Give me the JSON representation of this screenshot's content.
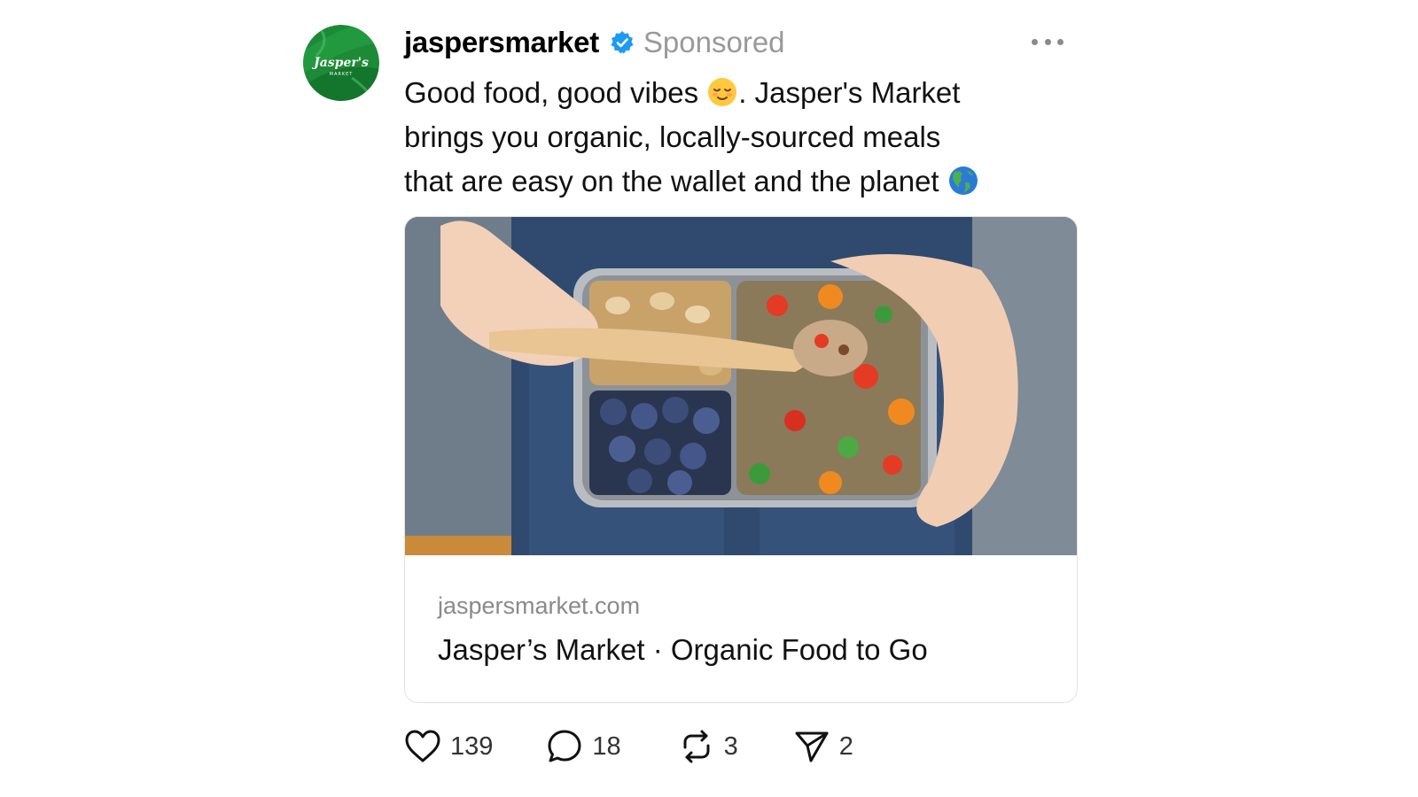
{
  "post": {
    "username": "jaspersmarket",
    "sponsored_label": "Sponsored",
    "avatar_logo_text": "Jasper's",
    "avatar_logo_subtext": "MARKET",
    "caption": {
      "line1_before_emoji": "Good food, good vibes ",
      "emoji1": "relieved-face",
      "line1_after_emoji": ". Jasper's Market",
      "line2": "brings you organic, locally-sourced meals",
      "line3_before_emoji": "that are easy on the wallet and the planet ",
      "emoji2": "globe-americas"
    },
    "colors": {
      "brand_green": "#1f8a3a",
      "verified_blue": "#1d9bf0",
      "muted_text": "#999999"
    }
  },
  "link_card": {
    "domain": "jaspersmarket.com",
    "title": "Jasper’s Market · Organic Food to Go",
    "image_description_icon": "lunchbox-photo"
  },
  "actions": {
    "likes": "139",
    "replies": "18",
    "reposts": "3",
    "shares": "2"
  }
}
